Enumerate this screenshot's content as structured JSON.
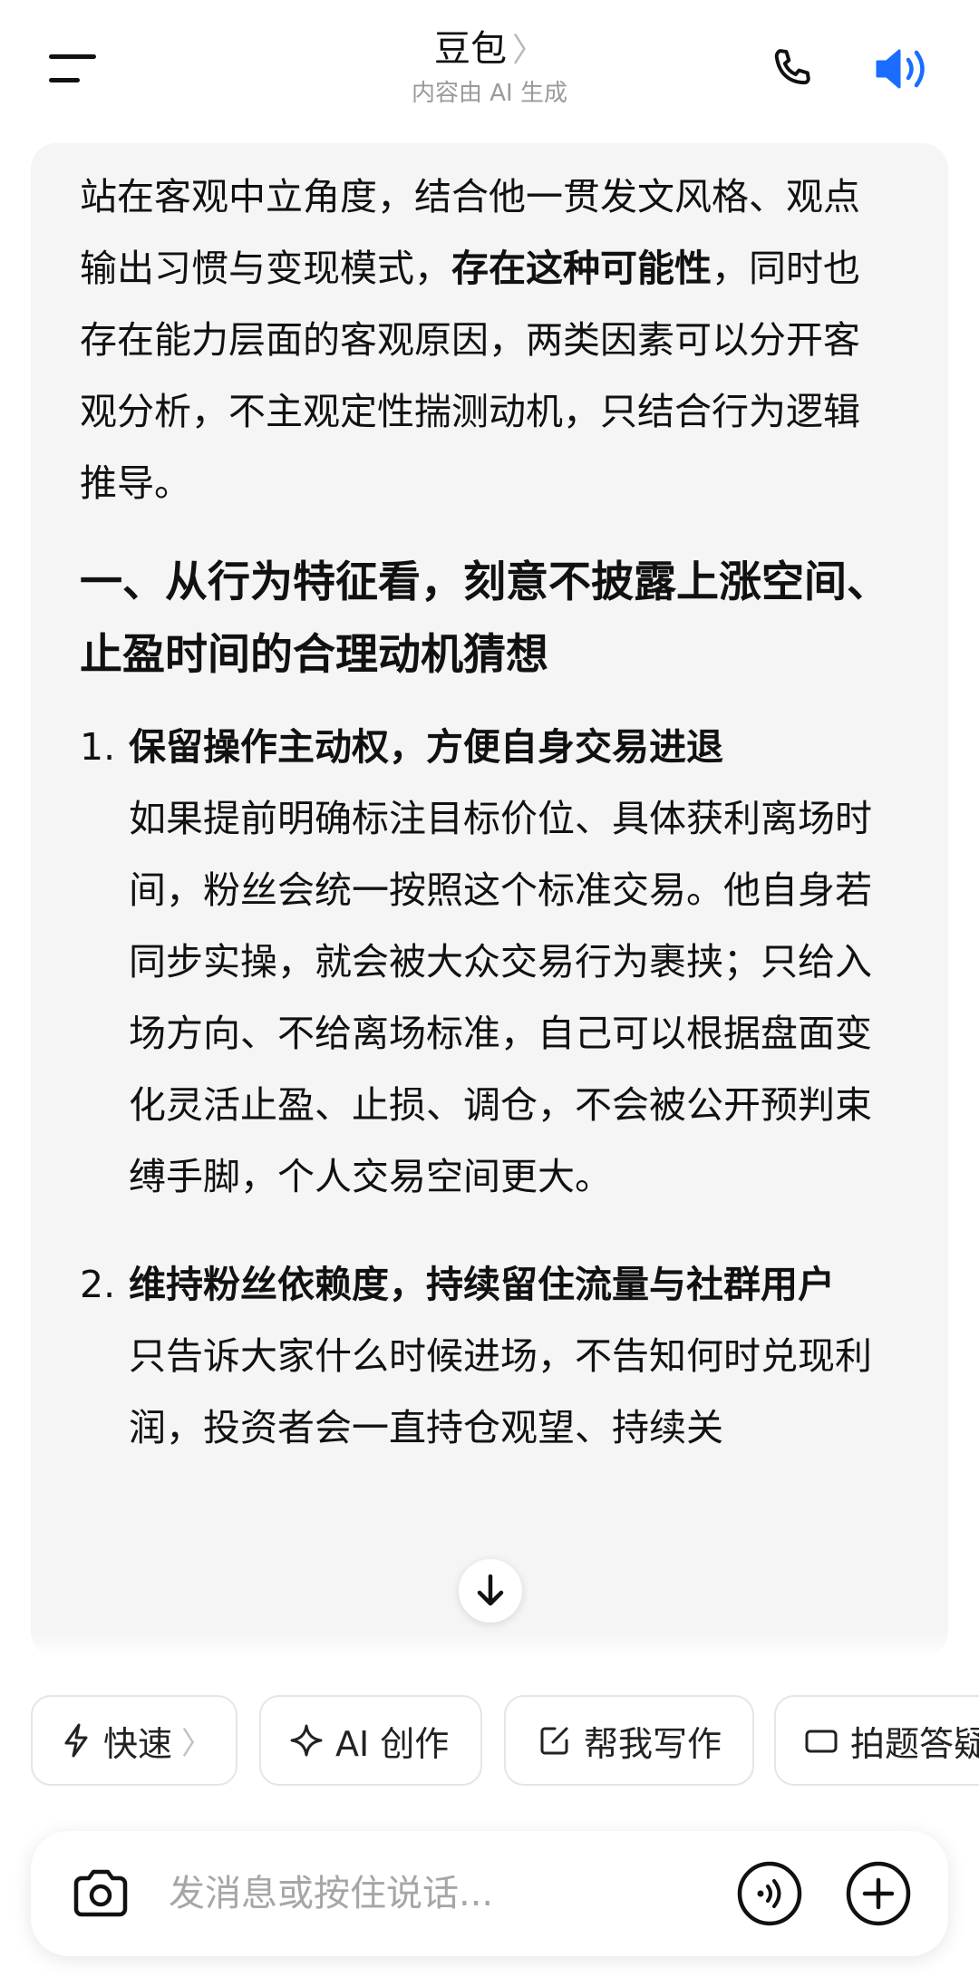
{
  "header": {
    "title": "豆包",
    "title_chevron": "〉",
    "subtitle": "内容由 AI 生成",
    "icons": {
      "menu": "menu-icon",
      "phone": "phone-icon",
      "speaker": "speaker-icon"
    },
    "accent_color": "#1a6dff"
  },
  "message": {
    "intro_parts": [
      "站在客观中立角度，结合他一贯发文风格、观点输出习惯与变现模式，",
      "存在这种可能性",
      "，同时也存在能力层面的客观原因，两类因素可以分开客观分析，不主观定性揣测动机，只结合行为逻辑推导。"
    ],
    "heading": "一、从行为特征看，刻意不披露上涨空间、止盈时间的合理动机猜想",
    "items": [
      {
        "num": "1.",
        "title": "保留操作主动权，方便自身交易进退",
        "body": "如果提前明确标注目标价位、具体获利离场时间，粉丝会统一按照这个标准交易。他自身若同步实操，就会被大众交易行为裹挟；只给入场方向、不给离场标准，自己可以根据盘面变化灵活止盈、止损、调仓，不会被公开预判束缚手脚，个人交易空间更大。"
      },
      {
        "num": "2.",
        "title": "维持粉丝依赖度，持续留住流量与社群用户",
        "body": "只告诉大家什么时候进场，不告知何时兑现利润，投资者会一直持仓观望、持续关"
      }
    ]
  },
  "chips": [
    {
      "label": "快速",
      "icon": "lightning-icon",
      "chevron": "〉"
    },
    {
      "label": "AI 创作",
      "icon": "sparkle-icon"
    },
    {
      "label": "帮我写作",
      "icon": "edit-icon"
    },
    {
      "label": "拍题答疑",
      "icon": "camera-icon"
    }
  ],
  "input": {
    "placeholder": "发消息或按住说话..."
  }
}
